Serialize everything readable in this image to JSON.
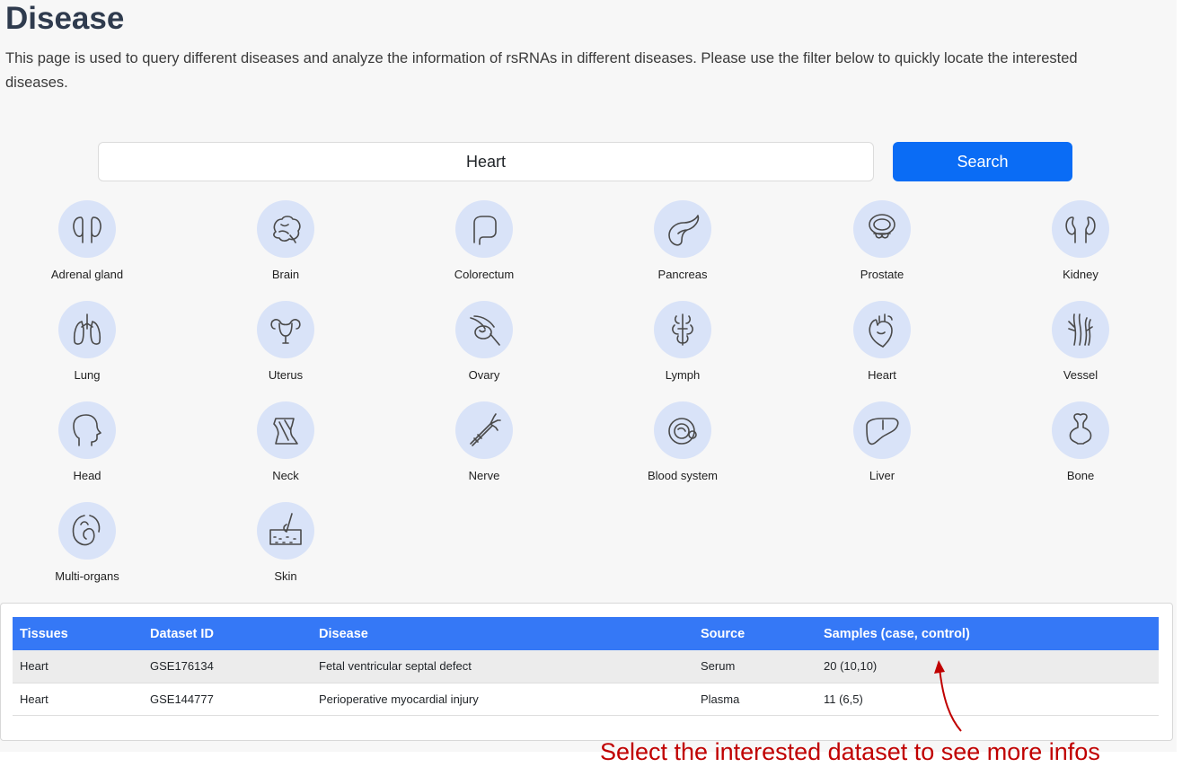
{
  "page": {
    "title": "Disease",
    "intro": "This page is used to query different diseases and analyze the information of rsRNAs in different diseases. Please use the filter below to quickly locate the interested diseases."
  },
  "search": {
    "value": "Heart",
    "placeholder": "",
    "button_label": "Search"
  },
  "tissues": [
    {
      "label": "Adrenal gland",
      "icon": "adrenal-gland-icon"
    },
    {
      "label": "Brain",
      "icon": "brain-icon"
    },
    {
      "label": "Colorectum",
      "icon": "colorectum-icon"
    },
    {
      "label": "Pancreas",
      "icon": "pancreas-icon"
    },
    {
      "label": "Prostate",
      "icon": "prostate-icon"
    },
    {
      "label": "Kidney",
      "icon": "kidney-icon"
    },
    {
      "label": "Lung",
      "icon": "lung-icon"
    },
    {
      "label": "Uterus",
      "icon": "uterus-icon"
    },
    {
      "label": "Ovary",
      "icon": "ovary-icon"
    },
    {
      "label": "Lymph",
      "icon": "lymph-icon"
    },
    {
      "label": "Heart",
      "icon": "heart-icon"
    },
    {
      "label": "Vessel",
      "icon": "vessel-icon"
    },
    {
      "label": "Head",
      "icon": "head-icon"
    },
    {
      "label": "Neck",
      "icon": "neck-icon"
    },
    {
      "label": "Nerve",
      "icon": "nerve-icon"
    },
    {
      "label": "Blood system",
      "icon": "blood-system-icon"
    },
    {
      "label": "Liver",
      "icon": "liver-icon"
    },
    {
      "label": "Bone",
      "icon": "bone-icon"
    },
    {
      "label": "Multi-organs",
      "icon": "multi-organs-icon"
    },
    {
      "label": "Skin",
      "icon": "skin-icon"
    }
  ],
  "table": {
    "headers": [
      "Tissues",
      "Dataset ID",
      "Disease",
      "Source",
      "Samples (case, control)"
    ],
    "rows": [
      [
        "Heart",
        "GSE176134",
        "Fetal ventricular septal defect",
        "Serum",
        "20 (10,10)"
      ],
      [
        "Heart",
        "GSE144777",
        "Perioperative myocardial injury",
        "Plasma",
        "11 (6,5)"
      ]
    ]
  },
  "annotation": {
    "text": "Select the interested dataset to see more infos",
    "color": "#c00000"
  },
  "colors": {
    "accent": "#0a6cf5",
    "table_header": "#3578f6",
    "icon_circle": "#d9e3f8"
  }
}
